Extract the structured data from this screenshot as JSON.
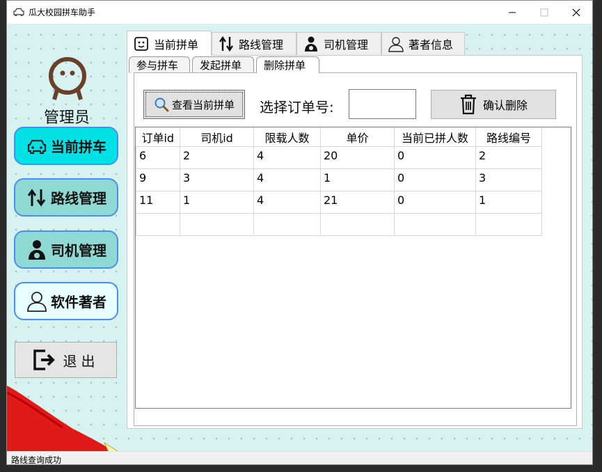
{
  "window": {
    "title": "瓜大校园拼车助手"
  },
  "sidebar": {
    "role": "管理员",
    "items": [
      {
        "label": "当前拼车",
        "icon": "car-icon",
        "color": "#00e1e6"
      },
      {
        "label": "路线管理",
        "icon": "route-arrows-icon",
        "color": "#8fd9d4"
      },
      {
        "label": "司机管理",
        "icon": "driver-icon",
        "color": "#8fd9d4"
      },
      {
        "label": "软件著者",
        "icon": "user-outline-icon",
        "color": "#e8ffff"
      }
    ],
    "exit_label": "退出"
  },
  "tabs": [
    {
      "label": "当前拼单",
      "icon": "face-icon",
      "active": true
    },
    {
      "label": "路线管理",
      "icon": "route-arrows-icon",
      "active": false
    },
    {
      "label": "司机管理",
      "icon": "driver-icon",
      "active": false
    },
    {
      "label": "著者信息",
      "icon": "user-outline-icon",
      "active": false
    }
  ],
  "subtabs": [
    {
      "label": "参与拼车",
      "active": false
    },
    {
      "label": "发起拼单",
      "active": false
    },
    {
      "label": "删除拼单",
      "active": true
    }
  ],
  "toolbar": {
    "query_label": "查看当前拼单",
    "select_label": "选择订单号:",
    "order_value": "",
    "delete_label": "确认删除"
  },
  "table": {
    "columns": [
      "订单id",
      "司机id",
      "限载人数",
      "单价",
      "当前已拼人数",
      "路线编号"
    ],
    "rows": [
      [
        "6",
        "2",
        "4",
        "20",
        "0",
        "2"
      ],
      [
        "9",
        "3",
        "4",
        "1",
        "0",
        "3"
      ],
      [
        "11",
        "1",
        "4",
        "21",
        "0",
        "1"
      ],
      [
        "",
        "",
        "",
        "",
        "",
        ""
      ]
    ]
  },
  "status": {
    "text": "路线查询成功"
  }
}
